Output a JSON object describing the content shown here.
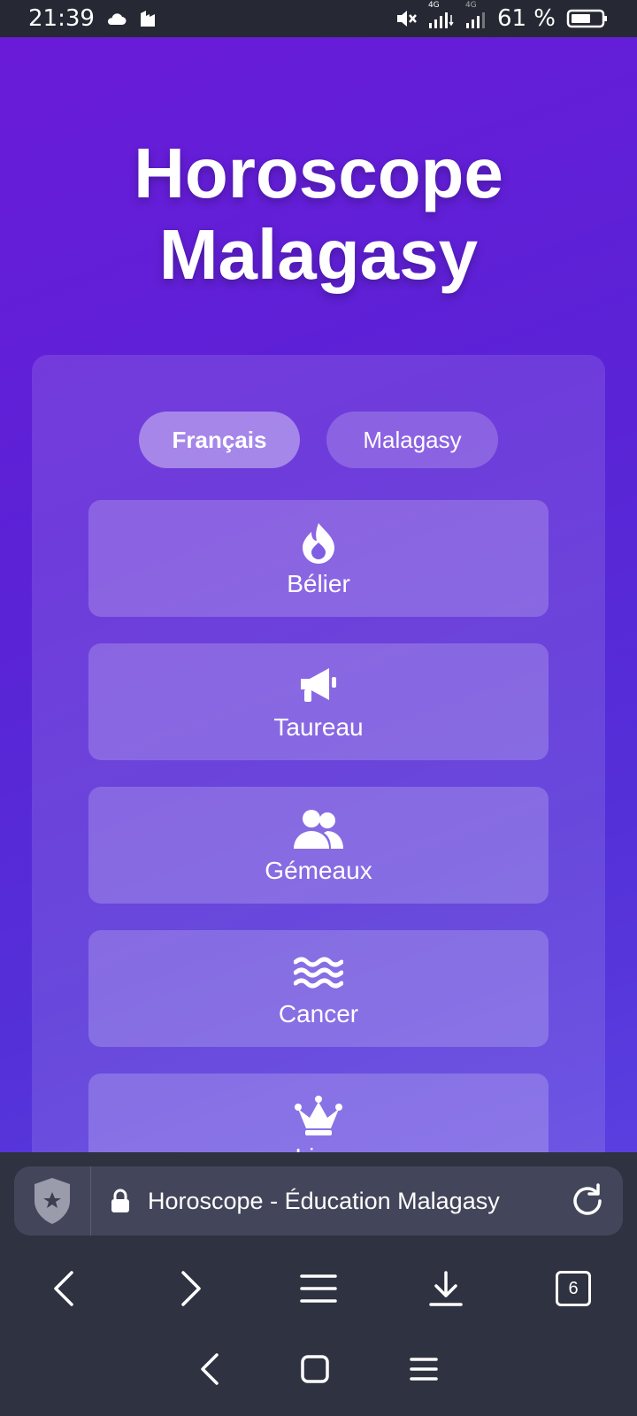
{
  "status_bar": {
    "time": "21:39",
    "battery_percent": "61 %",
    "network_label_1": "4G",
    "network_label_2": "4G",
    "icons": [
      "cloud-icon",
      "app-icon",
      "mute-icon",
      "signal-icon",
      "signal-icon",
      "battery-icon"
    ]
  },
  "page": {
    "title_line1": "Horoscope",
    "title_line2": "Malagasy",
    "languages": [
      {
        "label": "Français",
        "active": true
      },
      {
        "label": "Malagasy",
        "active": false
      }
    ],
    "signs": [
      {
        "label": "Bélier",
        "icon": "fire-icon"
      },
      {
        "label": "Taureau",
        "icon": "megaphone-icon"
      },
      {
        "label": "Gémeaux",
        "icon": "users-icon"
      },
      {
        "label": "Cancer",
        "icon": "water-icon"
      },
      {
        "label": "Lion",
        "icon": "crown-icon"
      }
    ]
  },
  "browser": {
    "url_text": "Horoscope - Éducation Malagasy",
    "tabs_count": "6",
    "icons": [
      "shield-icon",
      "lock-icon",
      "reload-icon",
      "back-icon",
      "forward-icon",
      "menu-icon",
      "download-icon",
      "tabs-icon"
    ]
  },
  "colors": {
    "gradient_start": "#6a1bd8",
    "gradient_end": "#5a3fe0",
    "browser_bg": "#2f3240",
    "urlbar_bg": "#43465a"
  }
}
